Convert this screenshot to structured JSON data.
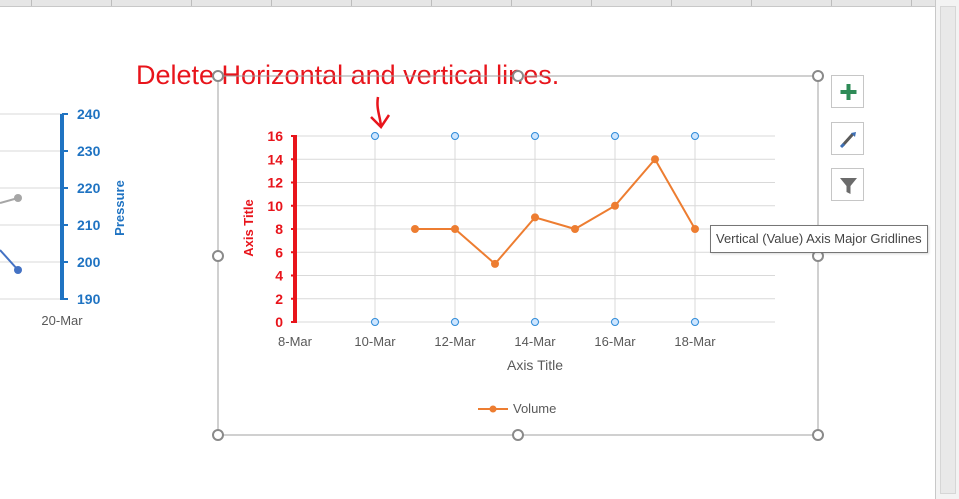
{
  "annotation": "Delete Horizontal and vertical lines.",
  "tooltip": "Vertical (Value) Axis Major Gridlines",
  "toolbar": {
    "add_icon": "plus-icon",
    "style_icon": "paintbrush-icon",
    "filter_icon": "filter-icon"
  },
  "left_chart": {
    "right_axis_title": "Pressure",
    "right_axis_ticks": [
      "240",
      "230",
      "220",
      "210",
      "200",
      "190"
    ],
    "x_tick": "20-Mar",
    "axis_color": "#1f73c2"
  },
  "chart_data": [
    {
      "type": "line",
      "title": "",
      "xlabel": "Axis Title",
      "ylabel": "Axis Title",
      "x_ticks": [
        "8-Mar",
        "10-Mar",
        "12-Mar",
        "14-Mar",
        "16-Mar",
        "18-Mar"
      ],
      "y_ticks": [
        "0",
        "2",
        "4",
        "6",
        "8",
        "10",
        "12",
        "14",
        "16"
      ],
      "xlim": [
        "8-Mar",
        "20-Mar"
      ],
      "ylim": [
        0,
        16
      ],
      "grid": true,
      "legend": "bottom",
      "series": [
        {
          "name": "Volume",
          "color": "#ed7d31",
          "x": [
            "11-Mar",
            "12-Mar",
            "13-Mar",
            "14-Mar",
            "15-Mar",
            "16-Mar",
            "17-Mar",
            "18-Mar"
          ],
          "y": [
            8,
            8,
            5,
            9,
            8,
            10,
            14,
            8
          ]
        }
      ],
      "y_axis_color": "#e8141b"
    }
  ]
}
